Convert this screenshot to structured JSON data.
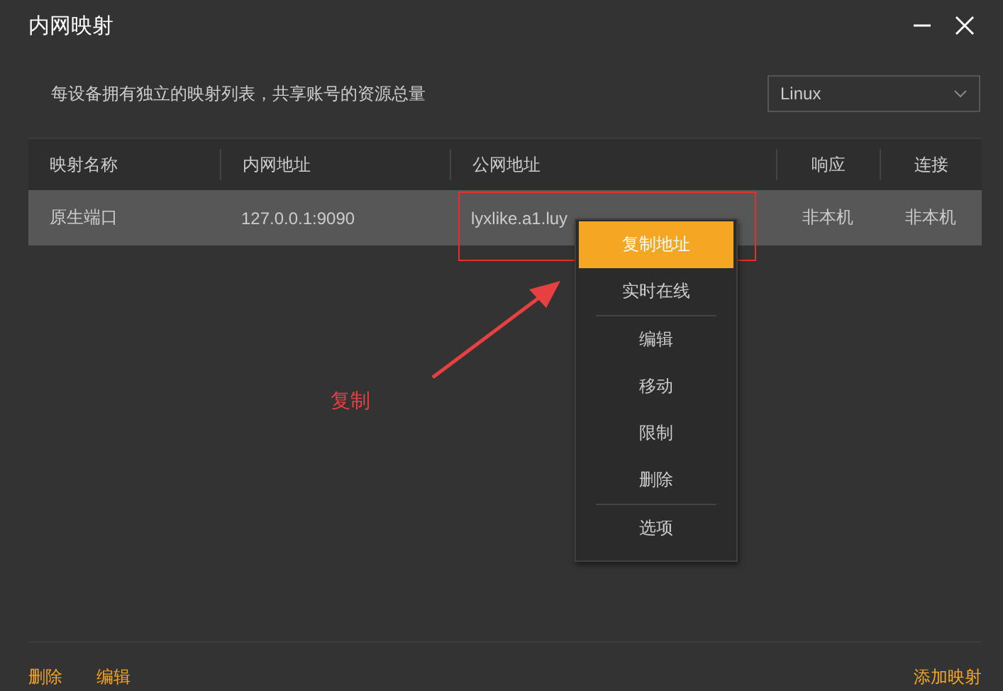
{
  "window": {
    "title": "内网映射"
  },
  "description": "每设备拥有独立的映射列表，共享账号的资源总量",
  "platform_select": {
    "value": "Linux"
  },
  "table": {
    "columns": [
      "映射名称",
      "内网地址",
      "公网地址",
      "响应",
      "连接"
    ],
    "rows": [
      {
        "selected": true,
        "cells": [
          "原生端口",
          "127.0.0.1:9090",
          "lyxlike.a1.luy",
          "非本机",
          "非本机"
        ]
      }
    ]
  },
  "context_menu": {
    "groups": [
      [
        {
          "label": "复制地址",
          "selected": true
        },
        {
          "label": "实时在线",
          "selected": false
        }
      ],
      [
        {
          "label": "编辑",
          "selected": false
        },
        {
          "label": "移动",
          "selected": false
        },
        {
          "label": "限制",
          "selected": false
        },
        {
          "label": "删除",
          "selected": false
        }
      ],
      [
        {
          "label": "选项",
          "selected": false
        }
      ]
    ]
  },
  "annotation": {
    "label": "复制"
  },
  "footer": {
    "left_links": [
      "删除",
      "编辑"
    ],
    "right_link": "添加映射"
  }
}
